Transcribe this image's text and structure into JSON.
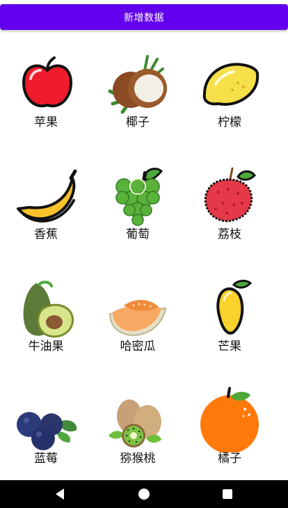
{
  "toolbar": {
    "add_button": "新增数据"
  },
  "fruits": [
    {
      "name": "苹果",
      "icon": "apple-icon"
    },
    {
      "name": "椰子",
      "icon": "coconut-icon"
    },
    {
      "name": "柠檬",
      "icon": "lemon-icon"
    },
    {
      "name": "香蕉",
      "icon": "banana-icon"
    },
    {
      "name": "葡萄",
      "icon": "grape-icon"
    },
    {
      "name": "荔枝",
      "icon": "lychee-icon"
    },
    {
      "name": "牛油果",
      "icon": "avocado-icon"
    },
    {
      "name": "哈密瓜",
      "icon": "cantaloupe-icon"
    },
    {
      "name": "芒果",
      "icon": "mango-icon"
    },
    {
      "name": "蓝莓",
      "icon": "blueberry-icon"
    },
    {
      "name": "猕猴桃",
      "icon": "kiwi-icon"
    },
    {
      "name": "橘子",
      "icon": "orange-icon"
    }
  ],
  "colors": {
    "accent": "#6200EE",
    "navbar": "#000000"
  },
  "navigation": {
    "back": "back-icon",
    "home": "home-icon",
    "recents": "recents-icon"
  }
}
